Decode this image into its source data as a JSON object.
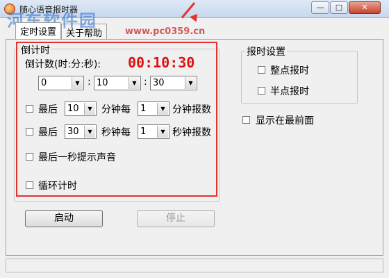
{
  "window": {
    "title": "随心语音报时器",
    "watermark": "河东软件园",
    "watermark_url": "www.pc0359.cn",
    "min_glyph": "—",
    "max_glyph": "□",
    "close_glyph": "✕"
  },
  "tabs": [
    {
      "label": "定时设置"
    },
    {
      "label": "关于帮助"
    }
  ],
  "countdown": {
    "group_title": "倒计时",
    "label": "倒计数(时:分:秒):",
    "display": "00:10:30",
    "hours": "0",
    "minutes": "10",
    "seconds": "30",
    "sep1": ":",
    "sep2": ":",
    "min_row": {
      "prefix": "最后",
      "value": "10",
      "middle": "分钟每",
      "every": "1",
      "suffix": "分钟报数"
    },
    "sec_row": {
      "prefix": "最后",
      "value": "30",
      "middle": "秒钟每",
      "every": "1",
      "suffix": "秒钟报数"
    },
    "last_second_sound": "最后一秒提示声音",
    "loop": "循环计时",
    "start_button": "启动",
    "stop_button": "停止"
  },
  "clock": {
    "group_title": "报时设置",
    "hourly": "整点报时",
    "half_hour": "半点报时"
  },
  "always_on_top": "显示在最前面",
  "colors": {
    "highlight": "#e53030",
    "time_display": "#e01010"
  }
}
